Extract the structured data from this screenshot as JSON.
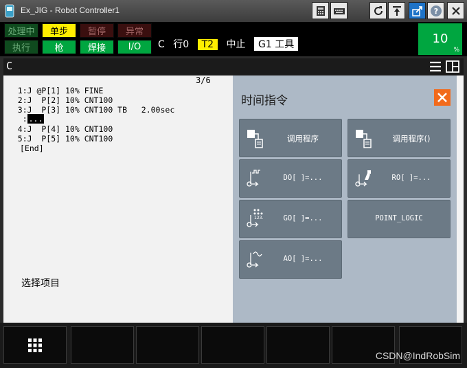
{
  "window": {
    "title": "Ex_JIG - Robot Controller1"
  },
  "status": {
    "busy": "处理中",
    "step": "单步",
    "hold": "暂停",
    "fault": "异常",
    "run": "执行",
    "gun": "枪",
    "weld": "焊接",
    "io": "I/O",
    "mode_text": "C",
    "line": "行0",
    "tool_mode": "T2",
    "state": "中止",
    "tool": "G1 工具"
  },
  "override": {
    "value": "10",
    "unit": "%"
  },
  "program_window": {
    "label": "C"
  },
  "program": {
    "line_count": "3/6",
    "lines": [
      "   1:J @P[1] 10% FINE",
      "   2:J  P[2] 10% CNT100",
      "   3:J  P[3] 10% CNT100 TB   2.00sec",
      "    :",
      "   4:J  P[4] 10% CNT100",
      "   5:J  P[5] 10% CNT100",
      "[End]"
    ],
    "cursor": "...",
    "prompt": "选择项目"
  },
  "panel": {
    "title": "时间指令",
    "buttons": [
      {
        "label": "调用程序"
      },
      {
        "label": "调用程序()"
      },
      {
        "label": "DO[ ]=..."
      },
      {
        "label": "RO[ ]=..."
      },
      {
        "label": "GO[ ]=..."
      },
      {
        "label": "POINT_LOGIC"
      },
      {
        "label": "AO[ ]=..."
      }
    ]
  },
  "watermark": "CSDN@IndRobSim",
  "colors": {
    "accent_green": "#00a640",
    "accent_yellow": "#ffee00",
    "close_orange": "#f26a1b",
    "panel_bg": "#adb9c6",
    "button_bg": "#6c7a86"
  }
}
